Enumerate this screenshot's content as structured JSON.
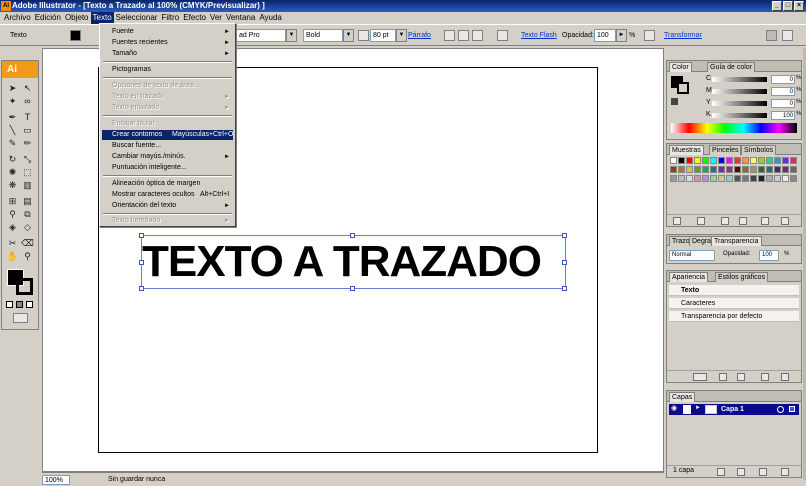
{
  "window": {
    "title": "Adobe Illustrator - [Texto a Trazado al 100% (CMYK/Previsualizar) ]",
    "buttons": [
      "_",
      "□",
      "×"
    ]
  },
  "menubar": [
    "Archivo",
    "Edición",
    "Objeto",
    "Texto",
    "Seleccionar",
    "Filtro",
    "Efecto",
    "Ver",
    "Ventana",
    "Ayuda"
  ],
  "control_bar": {
    "mode_label": "Texto",
    "font_name": "ad Pro",
    "font_style": "Bold",
    "font_size": "80 pt",
    "paragraph_link": "Párrafo",
    "text_flash_link": "Texto Flash",
    "opacity_label": "Opacidad:",
    "opacity_value": "100",
    "opacity_unit": "%",
    "transform_link": "Transformar"
  },
  "text_menu": {
    "items": [
      {
        "label": "Fuente",
        "submenu": true,
        "disabled": false
      },
      {
        "label": "Fuentes recientes",
        "submenu": true,
        "disabled": false
      },
      {
        "label": "Tamaño",
        "submenu": true,
        "disabled": false
      },
      {
        "label": "Pictogramas",
        "submenu": false,
        "disabled": false
      },
      {
        "label": "Opciones de texto de área...",
        "submenu": false,
        "disabled": true
      },
      {
        "label": "Texto en trazado",
        "submenu": true,
        "disabled": true
      },
      {
        "label": "Texto enlazado",
        "submenu": true,
        "disabled": true
      },
      {
        "label": "Encajar titular",
        "submenu": false,
        "disabled": true
      },
      {
        "label": "Crear contornos",
        "shortcut": "Mayúsculas+Ctrl+O",
        "submenu": false,
        "disabled": false,
        "highlighted": true
      },
      {
        "label": "Buscar fuente...",
        "submenu": false,
        "disabled": false
      },
      {
        "label": "Cambiar mayús./minús.",
        "submenu": true,
        "disabled": false
      },
      {
        "label": "Puntuación inteligente...",
        "submenu": false,
        "disabled": false
      },
      {
        "label": "Alineación óptica de margen",
        "submenu": false,
        "disabled": false
      },
      {
        "label": "Mostrar caracteres ocultos",
        "shortcut": "Alt+Ctrl+I",
        "submenu": false,
        "disabled": false
      },
      {
        "label": "Orientación del texto",
        "submenu": true,
        "disabled": false
      },
      {
        "label": "Texto heredado",
        "submenu": true,
        "disabled": true
      }
    ]
  },
  "tools_panel": {
    "logo": "Ai"
  },
  "canvas": {
    "text": "TEXTO A TRAZADO"
  },
  "status_bar": {
    "zoom": "100%",
    "status": "Sin guardar nunca"
  },
  "color_panel": {
    "tabs": [
      "Color",
      "Guía de color"
    ],
    "channels": [
      {
        "label": "C",
        "value": "0",
        "unit": "%"
      },
      {
        "label": "M",
        "value": "0",
        "unit": "%"
      },
      {
        "label": "Y",
        "value": "0",
        "unit": "%"
      },
      {
        "label": "K",
        "value": "100",
        "unit": "%"
      }
    ]
  },
  "swatches_panel": {
    "tabs": [
      "Muestras",
      "Pinceles",
      "Símbolos"
    ]
  },
  "transparency_panel": {
    "tabs": [
      "Trazo",
      "Degra",
      "Transparencia"
    ],
    "blend_mode": "Normal",
    "opacity_label": "Opacidad:",
    "opacity_value": "100",
    "opacity_unit": "%"
  },
  "appearance_panel": {
    "tabs": [
      "Apariencia",
      "Estilos gráficos"
    ],
    "rows": [
      "Texto",
      "Caracteres",
      "Transparencia por defecto"
    ]
  },
  "layers_panel": {
    "tabs": [
      "Capas"
    ],
    "layer_name": "Capa 1",
    "footer": "1 capa"
  },
  "colors": {
    "title_bar": "#0a246a",
    "menu_highlight": "#0a246a",
    "ai_logo": "#f39a1a",
    "selection": "#3a55c5",
    "layer_highlight": "#0a0a8c"
  }
}
